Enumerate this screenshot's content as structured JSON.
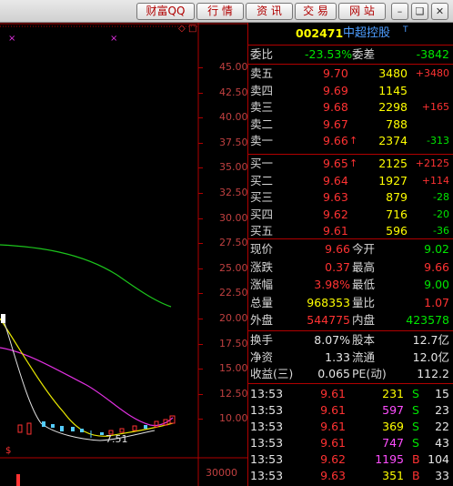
{
  "toolbar": {
    "buttons": [
      "财富QQ",
      "行 情",
      "资 讯",
      "交 易",
      "网 站"
    ],
    "window_controls": [
      "minimize-icon",
      "restore-icon",
      "close-icon"
    ]
  },
  "chart": {
    "price_axis_labels": [
      "45.00",
      "42.50",
      "40.00",
      "37.50",
      "35.00",
      "32.50",
      "30.00",
      "27.50",
      "25.00",
      "22.50",
      "20.00",
      "17.50",
      "15.00",
      "12.50",
      "10.00"
    ],
    "min_price_label": "7.51",
    "volume_axis_label": "30000",
    "top_markers": [
      "×",
      "×",
      "◇",
      "□"
    ],
    "price_marker": "$"
  },
  "stock": {
    "code": "002471",
    "name": "中超控股",
    "flag": "T"
  },
  "committee": {
    "ratio_label": "委比",
    "ratio_value": "-23.53%",
    "diff_label": "委差",
    "diff_value": "-3842"
  },
  "asks": [
    {
      "label": "卖五",
      "price": "9.70",
      "volume": "3480",
      "arrow": "",
      "change": "+3480"
    },
    {
      "label": "卖四",
      "price": "9.69",
      "volume": "1145",
      "arrow": "",
      "change": ""
    },
    {
      "label": "卖三",
      "price": "9.68",
      "volume": "2298",
      "arrow": "",
      "change": "+165"
    },
    {
      "label": "卖二",
      "price": "9.67",
      "volume": "788",
      "arrow": "",
      "change": ""
    },
    {
      "label": "卖一",
      "price": "9.66",
      "volume": "2374",
      "arrow": "↑",
      "change": "-313"
    }
  ],
  "bids": [
    {
      "label": "买一",
      "price": "9.65",
      "volume": "2125",
      "arrow": "↑",
      "change": "+2125"
    },
    {
      "label": "买二",
      "price": "9.64",
      "volume": "1927",
      "arrow": "",
      "change": "+114"
    },
    {
      "label": "买三",
      "price": "9.63",
      "volume": "879",
      "arrow": "",
      "change": "-28"
    },
    {
      "label": "买四",
      "price": "9.62",
      "volume": "716",
      "arrow": "",
      "change": "-20"
    },
    {
      "label": "买五",
      "price": "9.61",
      "volume": "596",
      "arrow": "",
      "change": "-36"
    }
  ],
  "quote": [
    {
      "l1": "现价",
      "v1": "9.66",
      "c1": "red",
      "l2": "今开",
      "v2": "9.02",
      "c2": "green"
    },
    {
      "l1": "涨跌",
      "v1": "0.37",
      "c1": "red",
      "l2": "最高",
      "v2": "9.66",
      "c2": "red"
    },
    {
      "l1": "涨幅",
      "v1": "3.98%",
      "c1": "red",
      "l2": "最低",
      "v2": "9.00",
      "c2": "green"
    },
    {
      "l1": "总量",
      "v1": "968353",
      "c1": "yellow",
      "l2": "量比",
      "v2": "1.07",
      "c2": "red"
    },
    {
      "l1": "外盘",
      "v1": "544775",
      "c1": "red",
      "l2": "内盘",
      "v2": "423578",
      "c2": "green"
    }
  ],
  "fundamentals": [
    {
      "l1": "换手",
      "v1": "8.07%",
      "l2": "股本",
      "v2": "12.7亿"
    },
    {
      "l1": "净资",
      "v1": "1.33",
      "l2": "流通",
      "v2": "12.0亿"
    },
    {
      "l1": "收益(三)",
      "v1": "0.065",
      "l2": "PE(动)",
      "v2": "112.2"
    }
  ],
  "ticks": [
    {
      "time": "13:53",
      "price": "9.61",
      "volume": "231",
      "side": "S",
      "count": "15",
      "vcolor": "yellow",
      "scolor": "green",
      "pcolor": "red"
    },
    {
      "time": "13:53",
      "price": "9.61",
      "volume": "597",
      "side": "S",
      "count": "23",
      "vcolor": "magenta",
      "scolor": "green",
      "pcolor": "red"
    },
    {
      "time": "13:53",
      "price": "9.61",
      "volume": "369",
      "side": "S",
      "count": "22",
      "vcolor": "yellow",
      "scolor": "green",
      "pcolor": "red"
    },
    {
      "time": "13:53",
      "price": "9.61",
      "volume": "747",
      "side": "S",
      "count": "43",
      "vcolor": "magenta",
      "scolor": "green",
      "pcolor": "red"
    },
    {
      "time": "13:53",
      "price": "9.62",
      "volume": "1195",
      "side": "B",
      "count": "104",
      "vcolor": "magenta",
      "scolor": "red",
      "pcolor": "red"
    },
    {
      "time": "13:53",
      "price": "9.63",
      "volume": "351",
      "side": "B",
      "count": "33",
      "vcolor": "yellow",
      "scolor": "red",
      "pcolor": "red"
    }
  ]
}
